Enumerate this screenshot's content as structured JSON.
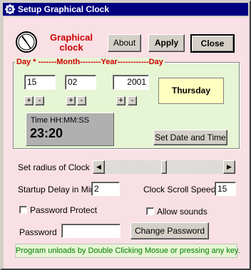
{
  "window": {
    "title": "Setup Graphical Clock"
  },
  "header": {
    "app_name_line1": "Graphical",
    "app_name_line2": "clock",
    "about_label": "About",
    "apply_label": "Apply",
    "close_label": "Close"
  },
  "date_group": {
    "header_text": "Day * -------Month--------Year------------Day",
    "day_value": "15",
    "month_value": "02",
    "year_value": "2001",
    "weekday": "Thursday",
    "plus": "+",
    "minus": "-"
  },
  "time_group": {
    "caption": "Time HH:MM:SS",
    "time_value": "23:20",
    "set_button_label": "Set Date and Time"
  },
  "settings": {
    "radius_label": "Set radius of Clock",
    "radius_level": 0.5,
    "startup_delay_label": "Startup Delay in Min",
    "startup_delay_value": "2",
    "scroll_speed_label": "Clock Scroll Speed",
    "scroll_speed_value": "15",
    "password_protect_label": "Password Protect",
    "allow_sounds_label": "Allow sounds",
    "password_label": "Password",
    "password_value": "",
    "change_password_label": "Change Password"
  },
  "footer": {
    "hint": "Program unloads by Double Clicking Mosue or pressing any key."
  },
  "colors": {
    "title_bg": "#000080",
    "client_bg": "#f9e0e5",
    "date_panel_bg": "#e6f5d4",
    "weekday_bg": "#ffffc0",
    "accent_red": "#cc0000",
    "hint_green": "#008000"
  }
}
